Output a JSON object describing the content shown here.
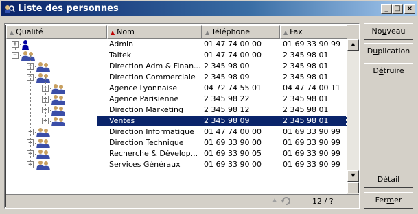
{
  "window": {
    "title": "Liste des personnes",
    "minimize_label": "_",
    "restore_label": "□",
    "close_label": "×"
  },
  "columns": {
    "qualite": "Qualité",
    "nom": "Nom",
    "telephone": "Téléphone",
    "fax": "Fax"
  },
  "rows": [
    {
      "nom": "Admin",
      "telephone": "01 47 74 00 00",
      "fax": "01 69 33 90 99",
      "depth": 0,
      "expander": "+",
      "icon": "person-icon"
    },
    {
      "nom": "Taltek",
      "telephone": "01 47 74 00 00",
      "fax": "2 345 98 01",
      "depth": 0,
      "expander": "−",
      "icon": "group-icon"
    },
    {
      "nom": "Direction Adm & Finan...",
      "telephone": "2 345 98 00",
      "fax": "2 345 98 01",
      "depth": 1,
      "expander": "+",
      "icon": "group-icon"
    },
    {
      "nom": "Direction Commerciale",
      "telephone": "2 345 98 09",
      "fax": "2 345 98 01",
      "depth": 1,
      "expander": "−",
      "icon": "group-icon"
    },
    {
      "nom": "Agence Lyonnaise",
      "telephone": "04 72 74 55 01",
      "fax": "04 47 74 00 11",
      "depth": 2,
      "expander": "+",
      "icon": "group-icon"
    },
    {
      "nom": "Agence Parisienne",
      "telephone": "2 345 98 22",
      "fax": "2 345 98 01",
      "depth": 2,
      "expander": "+",
      "icon": "group-icon"
    },
    {
      "nom": "Direction Marketing",
      "telephone": "2 345 98 12",
      "fax": "2 345 98 01",
      "depth": 2,
      "expander": "+",
      "icon": "group-icon"
    },
    {
      "nom": "Ventes",
      "telephone": "2 345 98 09",
      "fax": "2 345 98 01",
      "depth": 2,
      "expander": "+",
      "icon": "group-icon",
      "selected": true
    },
    {
      "nom": "Direction Informatique",
      "telephone": "01 47 74 00 00",
      "fax": "01 69 33 90 99",
      "depth": 1,
      "expander": "+",
      "icon": "group-icon"
    },
    {
      "nom": "Direction Technique",
      "telephone": "01 69 33 90 00",
      "fax": "01 69 33 90 99",
      "depth": 1,
      "expander": "+",
      "icon": "group-icon"
    },
    {
      "nom": "Recherche & Dévelop...",
      "telephone": "01 69 33 90 05",
      "fax": "01 69 33 90 99",
      "depth": 1,
      "expander": "+",
      "icon": "group-icon"
    },
    {
      "nom": "Services Généraux",
      "telephone": "01 69 33 90 00",
      "fax": "01 69 33 90 99",
      "depth": 1,
      "expander": "+",
      "icon": "group-icon"
    }
  ],
  "status": {
    "record_count": "12 / ?"
  },
  "buttons": {
    "nouveau": {
      "before": "No",
      "hot": "u",
      "after": "veau"
    },
    "duplication": {
      "before": "D",
      "hot": "u",
      "after": "plication"
    },
    "detruire": {
      "before": "D",
      "hot": "é",
      "after": "truire"
    },
    "detail": {
      "before": "",
      "hot": "D",
      "after": "étail"
    },
    "fermer": {
      "before": "Fer",
      "hot": "m",
      "after": "er"
    }
  },
  "colors": {
    "title_start": "#0a246a",
    "title_end": "#a6caf0",
    "selection": "#0a246a",
    "person_icon": "#0000a0",
    "group_icon_a": "#3b4ea8",
    "group_icon_b": "#c8a060"
  }
}
